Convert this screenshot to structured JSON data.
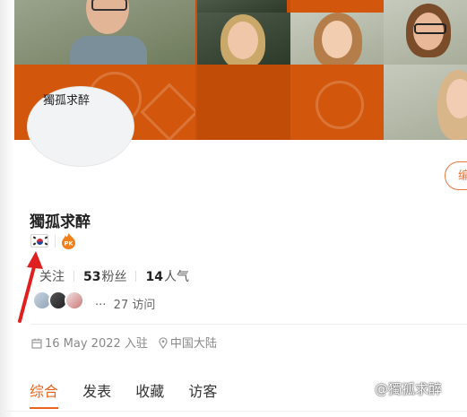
{
  "profile": {
    "avatar_text": "獨孤求醉",
    "username": "獨孤求醉",
    "edit_label": "编"
  },
  "stats": {
    "follow_label": "关注",
    "fans_count": "53",
    "fans_label": "粉丝",
    "popularity_count": "14",
    "popularity_label": "人气"
  },
  "visitors": {
    "ellipsis": "···",
    "text": "27 访问"
  },
  "meta": {
    "joined": "16 May 2022 入驻",
    "location": "中国大陆"
  },
  "tabs": [
    {
      "label": "综合",
      "active": true
    },
    {
      "label": "发表",
      "active": false
    },
    {
      "label": "收藏",
      "active": false
    },
    {
      "label": "访客",
      "active": false
    }
  ],
  "watermark": "@獨孤求醉",
  "colors": {
    "accent": "#e8641c",
    "banner_orange": "#d2570c",
    "arrow_red": "#e02020"
  },
  "icons": [
    "korea-flag-icon",
    "pk-badge-icon",
    "calendar-icon",
    "location-pin-icon"
  ]
}
